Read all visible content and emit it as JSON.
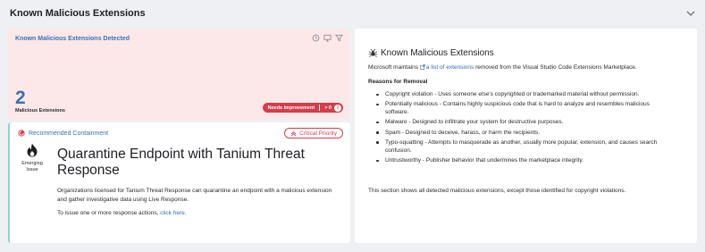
{
  "section": {
    "title": "Known Malicious Extensions",
    "collapse_icon": "chevron-down-icon"
  },
  "detected": {
    "title": "Known Malicious Extensions Detected",
    "count": "2",
    "count_label": "Malicious Extensions",
    "badge_label": "Needs Improvement",
    "badge_threshold": "> 0",
    "tools": [
      "history-icon",
      "monitor-icon",
      "filter-icon"
    ],
    "bg_color": "#fde8e9",
    "accent_color": "#3a70b6",
    "badge_color": "#d43d4a"
  },
  "containment": {
    "label": "Recommended Containment",
    "priority": "Critical Priority",
    "emerging_label": "Emerging Issue",
    "title": "Quarantine Endpoint with Tanium Threat Response",
    "description": "Organizations licensed for Tanium Threat Response can quarantine an endpoint with a malicious extension and gather investigative data using Live Response.",
    "action_prefix": "To issue one or more response actions,",
    "action_link": "click here."
  },
  "info": {
    "title": "Known Malicious Extensions",
    "intro_prefix": "Microsoft maintains",
    "intro_link": "a list of extensions",
    "intro_suffix": "removed from the Visual Studio Code Extensions Marketplace.",
    "reasons_heading": "Reasons for Removal",
    "reasons": [
      "Copyright violation - Uses someone else's copyrighted or trademarked material without permission.",
      "Potentially malicious - Contains highly suspicious code that is hard to analyze and resembles malicious software.",
      "Malware - Designed to infiltrate your system for destructive purposes.",
      "Spam - Designed to deceive, harass, or harm the recipients.",
      "Typo-squatting - Attempts to masquerade as another, usually more popular, extension, and causes search confusion.",
      "Untrustworthy - Publisher behavior that undermines the marketplace integrity."
    ],
    "footer": "This section shows all detected malicious extensions, except those identified for copyright violations."
  }
}
